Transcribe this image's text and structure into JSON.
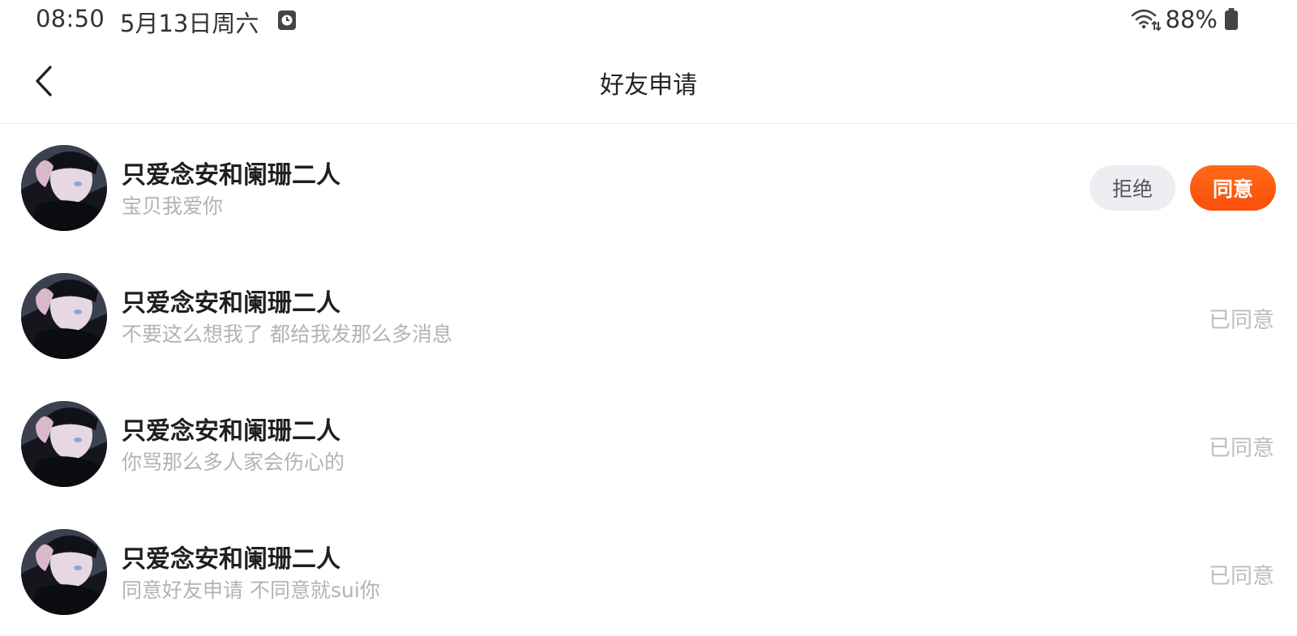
{
  "status_bar": {
    "time": "08:50",
    "date": "5月13日周六",
    "battery": "88%",
    "icons": [
      "clock-icon",
      "wifi-icon",
      "battery-icon"
    ]
  },
  "nav": {
    "title": "好友申请",
    "back_icon": "chevron-left-icon"
  },
  "colors": {
    "accent": "#FF5A0F",
    "reject_bg": "#ECEEF2",
    "muted_text": "#B3B3B3"
  },
  "requests": [
    {
      "name": "只爱念安和阑珊二人",
      "message": "宝贝我爱你",
      "state": "pending",
      "reject_label": "拒绝",
      "accept_label": "同意"
    },
    {
      "name": "只爱念安和阑珊二人",
      "message": "不要这么想我了 都给我发那么多消息",
      "state": "accepted",
      "status_label": "已同意"
    },
    {
      "name": "只爱念安和阑珊二人",
      "message": "你骂那么多人家会伤心的",
      "state": "accepted",
      "status_label": "已同意"
    },
    {
      "name": "只爱念安和阑珊二人",
      "message": "同意好友申请 不同意就sui你",
      "state": "accepted",
      "status_label": "已同意"
    }
  ]
}
